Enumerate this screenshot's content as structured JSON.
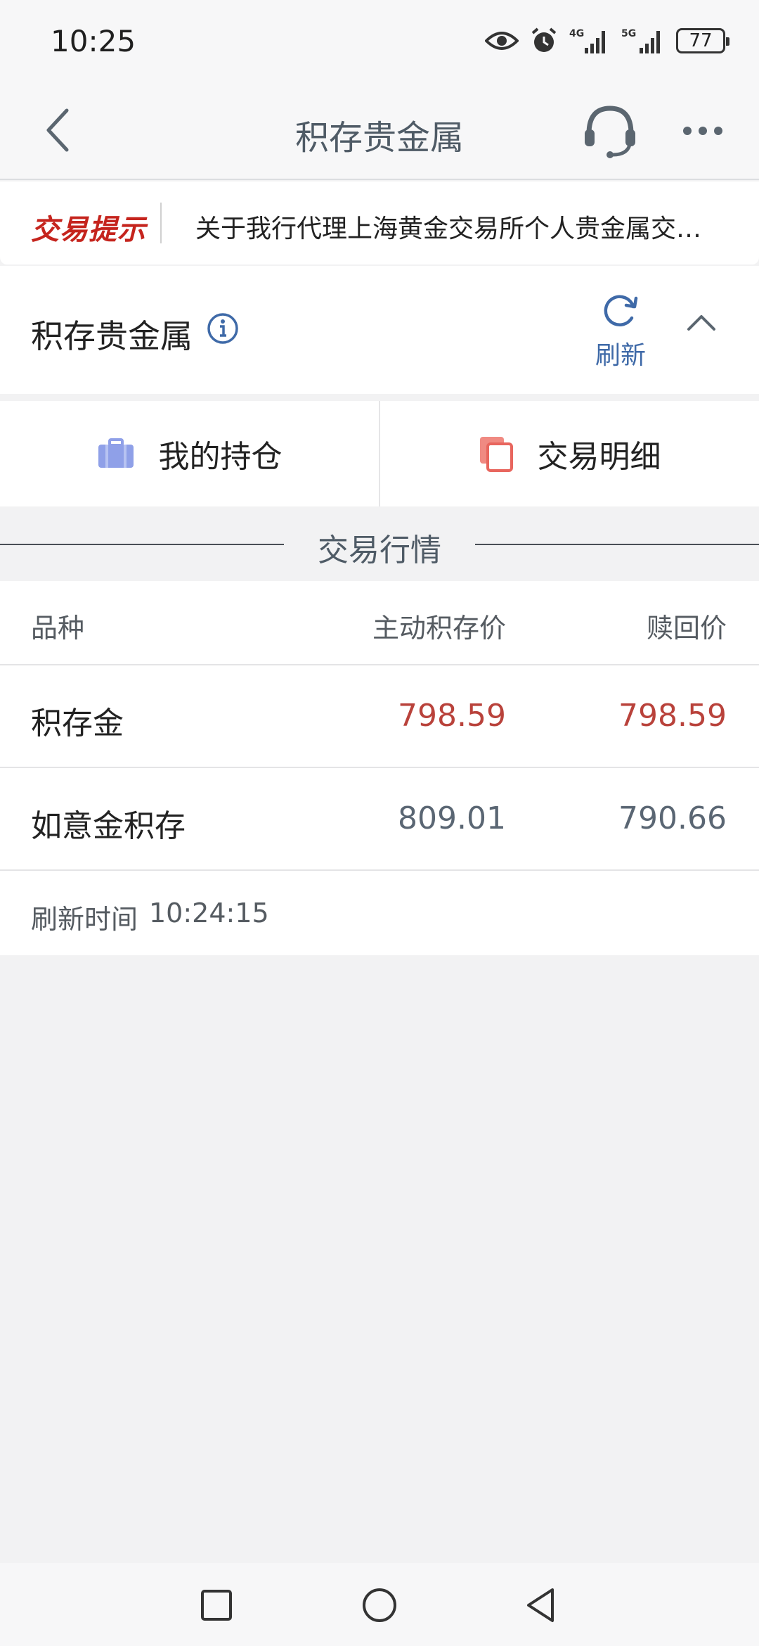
{
  "status": {
    "time": "10:25",
    "battery": "77",
    "network_1": "4G",
    "network_2": "5G"
  },
  "nav": {
    "title": "积存贵金属"
  },
  "notice": {
    "tag": "交易提示",
    "text": "关于我行代理上海黄金交易所个人贵金属交…"
  },
  "section": {
    "title": "积存贵金属",
    "refresh_label": "刷新"
  },
  "actions": {
    "positions_label": "我的持仓",
    "details_label": "交易明细"
  },
  "market": {
    "title": "交易行情",
    "columns": [
      "品种",
      "主动积存价",
      "赎回价"
    ],
    "rows": [
      {
        "name": "积存金",
        "active_price": "798.59",
        "redeem_price": "798.59"
      },
      {
        "name": "如意金积存",
        "active_price": "809.01",
        "redeem_price": "790.66"
      }
    ],
    "refresh_time_label": "刷新时间",
    "refresh_time": "10:24:15"
  },
  "colors": {
    "accent_blue": "#3f6aa8",
    "price_red": "#b9423b",
    "notice_red": "#c5241d"
  }
}
